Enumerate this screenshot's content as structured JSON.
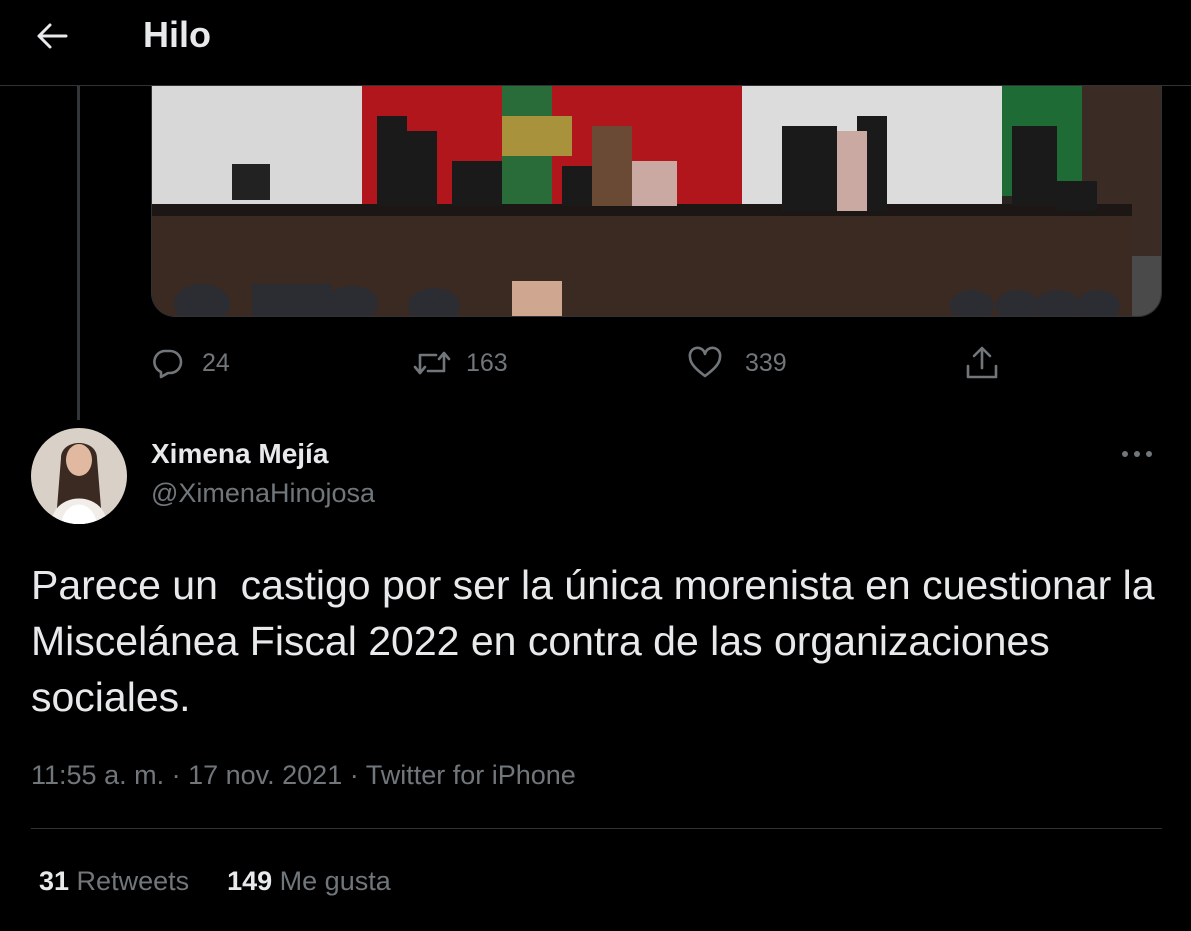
{
  "header": {
    "title": "Hilo",
    "back_icon": "arrow-left-icon"
  },
  "media": {
    "alt": "Cámara de Diputados"
  },
  "actions": {
    "reply_count": "24",
    "retweet_count": "163",
    "like_count": "339"
  },
  "tweet": {
    "author_name": "Ximena Mejía",
    "author_handle": "@XimenaHinojosa",
    "text": "Parece un  castigo por ser la única morenista en cuestionar la Miscelánea Fiscal 2022 en contra de las organizaciones sociales.",
    "time": "11:55 a. m.",
    "sep1": " · ",
    "date": "17 nov. 2021",
    "sep2": " · ",
    "source": "Twitter for iPhone"
  },
  "stats": {
    "retweets_count": "31",
    "retweets_label": " Retweets",
    "likes_count": "149",
    "likes_label": " Me gusta"
  },
  "colors": {
    "background": "#000000",
    "text": "#e7e9ea",
    "secondary": "#71767b",
    "border": "#2f3336"
  }
}
